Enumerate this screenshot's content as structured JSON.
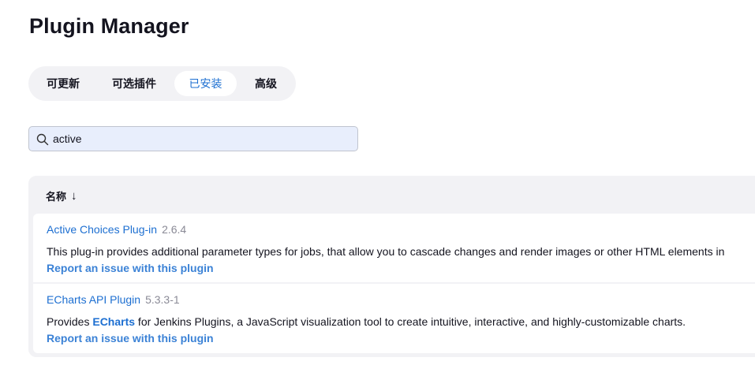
{
  "page": {
    "title": "Plugin Manager"
  },
  "tabs": [
    {
      "label": "可更新",
      "active": false
    },
    {
      "label": "可选插件",
      "active": false
    },
    {
      "label": "已安装",
      "active": true
    },
    {
      "label": "高级",
      "active": false
    }
  ],
  "search": {
    "value": "active",
    "placeholder": ""
  },
  "table": {
    "header_name": "名称",
    "sort_indicator": "↓",
    "rows": [
      {
        "name": "Active Choices Plug-in",
        "version": "2.6.4",
        "desc_before": "This plug-in provides additional parameter types for jobs, that allow you to cascade changes and render images or other HTML elements in",
        "desc_link": "",
        "desc_after": "",
        "report": "Report an issue with this plugin"
      },
      {
        "name": "ECharts API Plugin",
        "version": "5.3.3-1",
        "desc_before": "Provides ",
        "desc_link": "ECharts",
        "desc_after": " for Jenkins Plugins, a JavaScript visualization tool to create intuitive, interactive, and highly-customizable charts.",
        "report": "Report an issue with this plugin"
      }
    ]
  },
  "colors": {
    "accent": "#1d6fd1",
    "tab_bg": "#f2f2f5",
    "search_bg": "#e8eefc"
  },
  "icons": {
    "search": "search-icon",
    "sort": "arrow-down-icon"
  }
}
